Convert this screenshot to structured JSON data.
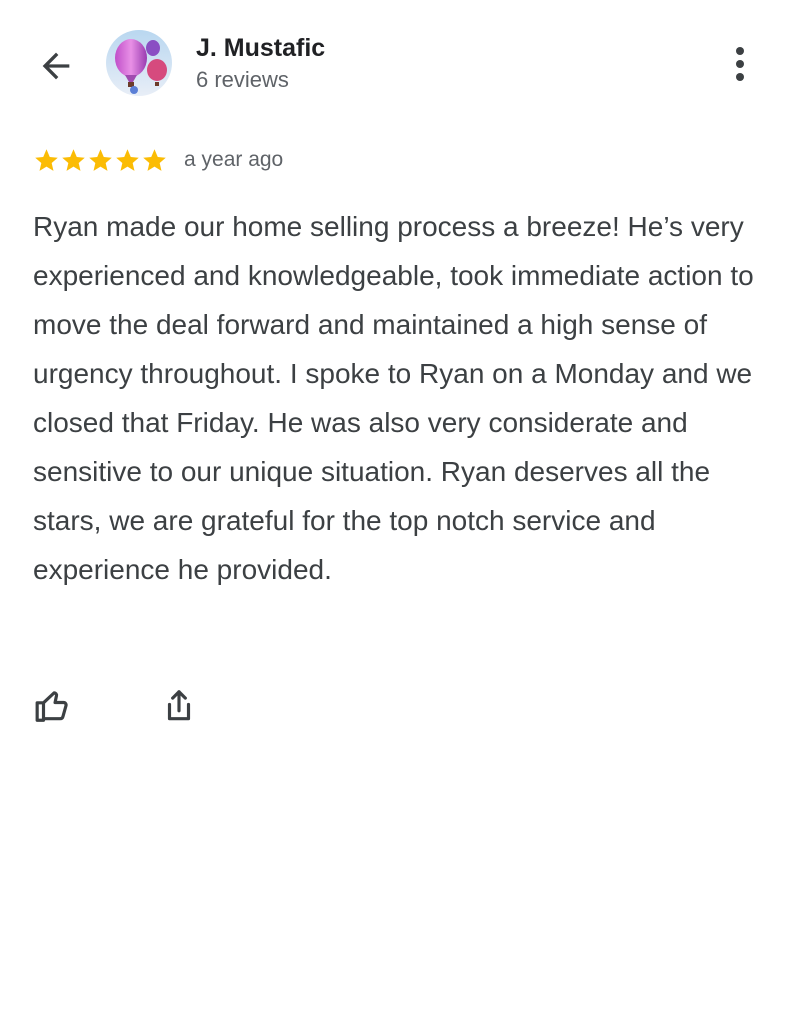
{
  "header": {
    "back_icon": "arrow-left-icon",
    "avatar_icon": "hot-air-balloon-avatar",
    "user_name": "J. Mustafic",
    "review_count": "6 reviews",
    "more_icon": "more-vertical-icon"
  },
  "review": {
    "rating": 5,
    "rating_max": 5,
    "star_color": "#fbbc04",
    "time": "a year ago",
    "text": "Ryan made our home selling process a breeze! He’s very experienced and knowledgeable, took immediate action to move the deal forward and maintained a high sense of urgency throughout. I spoke to Ryan on a Monday and we closed that Friday. He was also very considerate and sensitive to our unique situation. Ryan deserves all the stars, we are grateful for the top notch service and experience he provided."
  },
  "actions": {
    "like_icon": "thumbs-up-icon",
    "share_icon": "share-icon"
  }
}
